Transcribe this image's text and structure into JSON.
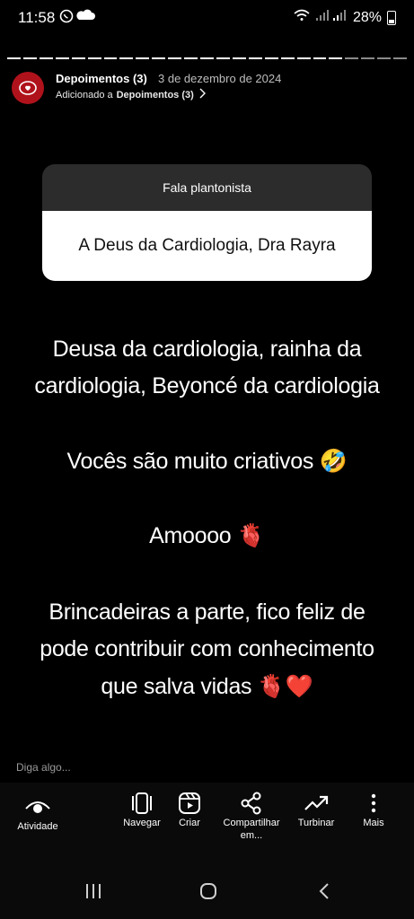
{
  "status": {
    "time": "11:58",
    "battery": "28%"
  },
  "story": {
    "owner": "Depoimentos (3)",
    "date": "3 de dezembro de 2024",
    "added_prefix": "Adicionado a",
    "added_target": "Depoimentos (3)",
    "question": {
      "title": "Fala plantonista",
      "answer": "A Deus da Cardiologia,  Dra Rayra"
    },
    "caption": {
      "line1": "Deusa da cardiologia, rainha da",
      "line2": "cardiologia, Beyoncé da cardiologia",
      "line3": "Vocês são muito criativos 🤣",
      "line4": "Amoooo 🫀",
      "line5": "Brincadeiras a parte, fico feliz de",
      "line6": "pode contribuir com conhecimento",
      "line7": "que salva vidas 🫀❤️"
    },
    "reply_placeholder": "Diga algo..."
  },
  "actions": {
    "activity": "Atividade",
    "browse": "Navegar",
    "create": "Criar",
    "share": "Compartilhar em...",
    "boost": "Turbinar",
    "more": "Mais"
  },
  "colors": {
    "accent": "#b0121b",
    "background": "#000000"
  }
}
